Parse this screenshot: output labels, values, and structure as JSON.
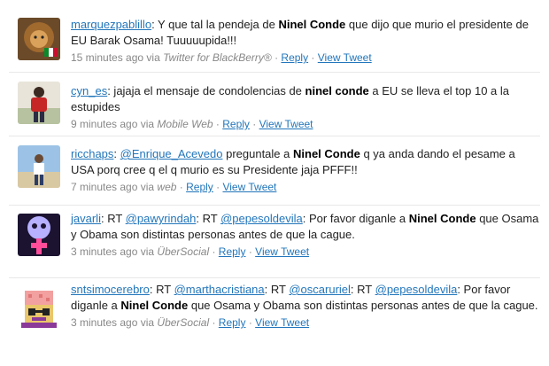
{
  "tweets": [
    {
      "user": "marquezpablillo",
      "segments": [
        {
          "t": ": Y que tal la pendeja de "
        },
        {
          "t": "Ninel Conde",
          "b": true
        },
        {
          "t": " que dijo que murio el presidente de EU Barak Osama! Tuuuuupida!!!"
        }
      ],
      "time": "15 minutes ago",
      "via": "via",
      "source": "Twitter for BlackBerry®",
      "reply": "Reply",
      "view": "View Tweet"
    },
    {
      "user": "cyn_es",
      "segments": [
        {
          "t": ": jajaja el mensaje de condolencias de "
        },
        {
          "t": "ninel conde",
          "b": true
        },
        {
          "t": " a EU se lleva el top 10 a la estupides"
        }
      ],
      "time": "9 minutes ago",
      "via": "via",
      "source": "Mobile Web",
      "reply": "Reply",
      "view": "View Tweet"
    },
    {
      "user": "ricchaps",
      "segments": [
        {
          "t": ": "
        },
        {
          "t": "@Enrique_Acevedo",
          "m": true
        },
        {
          "t": " preguntale a "
        },
        {
          "t": "Ninel Conde",
          "b": true
        },
        {
          "t": " q ya anda dando el pesame a USA porq cree q el q murio es su Presidente jaja PFFF!!"
        }
      ],
      "time": "7 minutes ago",
      "via": "via",
      "source": "web",
      "reply": "Reply",
      "view": "View Tweet"
    },
    {
      "user": "javarli",
      "segments": [
        {
          "t": ": RT "
        },
        {
          "t": "@pawyrindah",
          "m": true
        },
        {
          "t": ": RT "
        },
        {
          "t": "@pepesoldevila",
          "m": true
        },
        {
          "t": ": Por favor diganle a "
        },
        {
          "t": "Ninel Conde",
          "b": true
        },
        {
          "t": " que Osama y Obama son distintas personas antes de que la cague."
        }
      ],
      "time": "3 minutes ago",
      "via": "via",
      "source": "ÜberSocial",
      "reply": "Reply",
      "view": "View Tweet"
    },
    {
      "user": "sntsimocerebro",
      "segments": [
        {
          "t": ": RT "
        },
        {
          "t": "@marthacristiana",
          "m": true
        },
        {
          "t": ": RT "
        },
        {
          "t": "@oscaruriel",
          "m": true
        },
        {
          "t": ": RT "
        },
        {
          "t": "@pepesoldevila",
          "m": true
        },
        {
          "t": ": Por favor diganle a "
        },
        {
          "t": "Ninel Conde",
          "b": true
        },
        {
          "t": " que Osama y Obama son distintas personas antes de que la cague."
        }
      ],
      "time": "3 minutes ago",
      "via": "via",
      "source": "ÜberSocial",
      "reply": "Reply",
      "view": "View Tweet"
    }
  ],
  "colors": {
    "link": "#2276bb",
    "meta": "#888888",
    "separator": "#e8e8e8"
  },
  "avatar_icons": [
    "lion-avatar-icon",
    "person-red-shirt-avatar-icon",
    "person-beach-avatar-icon",
    "pink-cross-robot-avatar-icon",
    "pixel-brain-avatar-icon"
  ]
}
